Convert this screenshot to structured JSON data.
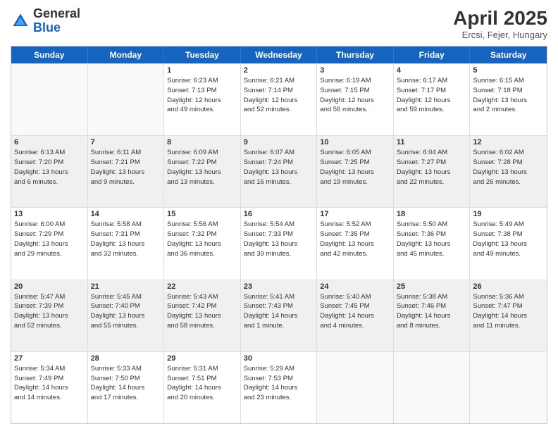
{
  "header": {
    "logo": {
      "general": "General",
      "blue": "Blue"
    },
    "title": "April 2025",
    "location": "Ercsi, Fejer, Hungary"
  },
  "days": [
    "Sunday",
    "Monday",
    "Tuesday",
    "Wednesday",
    "Thursday",
    "Friday",
    "Saturday"
  ],
  "rows": [
    [
      {
        "day": "",
        "empty": true,
        "shaded": false,
        "lines": []
      },
      {
        "day": "",
        "empty": true,
        "shaded": false,
        "lines": []
      },
      {
        "day": "1",
        "empty": false,
        "shaded": false,
        "lines": [
          "Sunrise: 6:23 AM",
          "Sunset: 7:13 PM",
          "Daylight: 12 hours",
          "and 49 minutes."
        ]
      },
      {
        "day": "2",
        "empty": false,
        "shaded": false,
        "lines": [
          "Sunrise: 6:21 AM",
          "Sunset: 7:14 PM",
          "Daylight: 12 hours",
          "and 52 minutes."
        ]
      },
      {
        "day": "3",
        "empty": false,
        "shaded": false,
        "lines": [
          "Sunrise: 6:19 AM",
          "Sunset: 7:15 PM",
          "Daylight: 12 hours",
          "and 56 minutes."
        ]
      },
      {
        "day": "4",
        "empty": false,
        "shaded": false,
        "lines": [
          "Sunrise: 6:17 AM",
          "Sunset: 7:17 PM",
          "Daylight: 12 hours",
          "and 59 minutes."
        ]
      },
      {
        "day": "5",
        "empty": false,
        "shaded": false,
        "lines": [
          "Sunrise: 6:15 AM",
          "Sunset: 7:18 PM",
          "Daylight: 13 hours",
          "and 2 minutes."
        ]
      }
    ],
    [
      {
        "day": "6",
        "empty": false,
        "shaded": true,
        "lines": [
          "Sunrise: 6:13 AM",
          "Sunset: 7:20 PM",
          "Daylight: 13 hours",
          "and 6 minutes."
        ]
      },
      {
        "day": "7",
        "empty": false,
        "shaded": true,
        "lines": [
          "Sunrise: 6:11 AM",
          "Sunset: 7:21 PM",
          "Daylight: 13 hours",
          "and 9 minutes."
        ]
      },
      {
        "day": "8",
        "empty": false,
        "shaded": true,
        "lines": [
          "Sunrise: 6:09 AM",
          "Sunset: 7:22 PM",
          "Daylight: 13 hours",
          "and 13 minutes."
        ]
      },
      {
        "day": "9",
        "empty": false,
        "shaded": true,
        "lines": [
          "Sunrise: 6:07 AM",
          "Sunset: 7:24 PM",
          "Daylight: 13 hours",
          "and 16 minutes."
        ]
      },
      {
        "day": "10",
        "empty": false,
        "shaded": true,
        "lines": [
          "Sunrise: 6:05 AM",
          "Sunset: 7:25 PM",
          "Daylight: 13 hours",
          "and 19 minutes."
        ]
      },
      {
        "day": "11",
        "empty": false,
        "shaded": true,
        "lines": [
          "Sunrise: 6:04 AM",
          "Sunset: 7:27 PM",
          "Daylight: 13 hours",
          "and 22 minutes."
        ]
      },
      {
        "day": "12",
        "empty": false,
        "shaded": true,
        "lines": [
          "Sunrise: 6:02 AM",
          "Sunset: 7:28 PM",
          "Daylight: 13 hours",
          "and 26 minutes."
        ]
      }
    ],
    [
      {
        "day": "13",
        "empty": false,
        "shaded": false,
        "lines": [
          "Sunrise: 6:00 AM",
          "Sunset: 7:29 PM",
          "Daylight: 13 hours",
          "and 29 minutes."
        ]
      },
      {
        "day": "14",
        "empty": false,
        "shaded": false,
        "lines": [
          "Sunrise: 5:58 AM",
          "Sunset: 7:31 PM",
          "Daylight: 13 hours",
          "and 32 minutes."
        ]
      },
      {
        "day": "15",
        "empty": false,
        "shaded": false,
        "lines": [
          "Sunrise: 5:56 AM",
          "Sunset: 7:32 PM",
          "Daylight: 13 hours",
          "and 36 minutes."
        ]
      },
      {
        "day": "16",
        "empty": false,
        "shaded": false,
        "lines": [
          "Sunrise: 5:54 AM",
          "Sunset: 7:33 PM",
          "Daylight: 13 hours",
          "and 39 minutes."
        ]
      },
      {
        "day": "17",
        "empty": false,
        "shaded": false,
        "lines": [
          "Sunrise: 5:52 AM",
          "Sunset: 7:35 PM",
          "Daylight: 13 hours",
          "and 42 minutes."
        ]
      },
      {
        "day": "18",
        "empty": false,
        "shaded": false,
        "lines": [
          "Sunrise: 5:50 AM",
          "Sunset: 7:36 PM",
          "Daylight: 13 hours",
          "and 45 minutes."
        ]
      },
      {
        "day": "19",
        "empty": false,
        "shaded": false,
        "lines": [
          "Sunrise: 5:49 AM",
          "Sunset: 7:38 PM",
          "Daylight: 13 hours",
          "and 49 minutes."
        ]
      }
    ],
    [
      {
        "day": "20",
        "empty": false,
        "shaded": true,
        "lines": [
          "Sunrise: 5:47 AM",
          "Sunset: 7:39 PM",
          "Daylight: 13 hours",
          "and 52 minutes."
        ]
      },
      {
        "day": "21",
        "empty": false,
        "shaded": true,
        "lines": [
          "Sunrise: 5:45 AM",
          "Sunset: 7:40 PM",
          "Daylight: 13 hours",
          "and 55 minutes."
        ]
      },
      {
        "day": "22",
        "empty": false,
        "shaded": true,
        "lines": [
          "Sunrise: 5:43 AM",
          "Sunset: 7:42 PM",
          "Daylight: 13 hours",
          "and 58 minutes."
        ]
      },
      {
        "day": "23",
        "empty": false,
        "shaded": true,
        "lines": [
          "Sunrise: 5:41 AM",
          "Sunset: 7:43 PM",
          "Daylight: 14 hours",
          "and 1 minute."
        ]
      },
      {
        "day": "24",
        "empty": false,
        "shaded": true,
        "lines": [
          "Sunrise: 5:40 AM",
          "Sunset: 7:45 PM",
          "Daylight: 14 hours",
          "and 4 minutes."
        ]
      },
      {
        "day": "25",
        "empty": false,
        "shaded": true,
        "lines": [
          "Sunrise: 5:38 AM",
          "Sunset: 7:46 PM",
          "Daylight: 14 hours",
          "and 8 minutes."
        ]
      },
      {
        "day": "26",
        "empty": false,
        "shaded": true,
        "lines": [
          "Sunrise: 5:36 AM",
          "Sunset: 7:47 PM",
          "Daylight: 14 hours",
          "and 11 minutes."
        ]
      }
    ],
    [
      {
        "day": "27",
        "empty": false,
        "shaded": false,
        "lines": [
          "Sunrise: 5:34 AM",
          "Sunset: 7:49 PM",
          "Daylight: 14 hours",
          "and 14 minutes."
        ]
      },
      {
        "day": "28",
        "empty": false,
        "shaded": false,
        "lines": [
          "Sunrise: 5:33 AM",
          "Sunset: 7:50 PM",
          "Daylight: 14 hours",
          "and 17 minutes."
        ]
      },
      {
        "day": "29",
        "empty": false,
        "shaded": false,
        "lines": [
          "Sunrise: 5:31 AM",
          "Sunset: 7:51 PM",
          "Daylight: 14 hours",
          "and 20 minutes."
        ]
      },
      {
        "day": "30",
        "empty": false,
        "shaded": false,
        "lines": [
          "Sunrise: 5:29 AM",
          "Sunset: 7:53 PM",
          "Daylight: 14 hours",
          "and 23 minutes."
        ]
      },
      {
        "day": "",
        "empty": true,
        "shaded": false,
        "lines": []
      },
      {
        "day": "",
        "empty": true,
        "shaded": false,
        "lines": []
      },
      {
        "day": "",
        "empty": true,
        "shaded": false,
        "lines": []
      }
    ]
  ]
}
